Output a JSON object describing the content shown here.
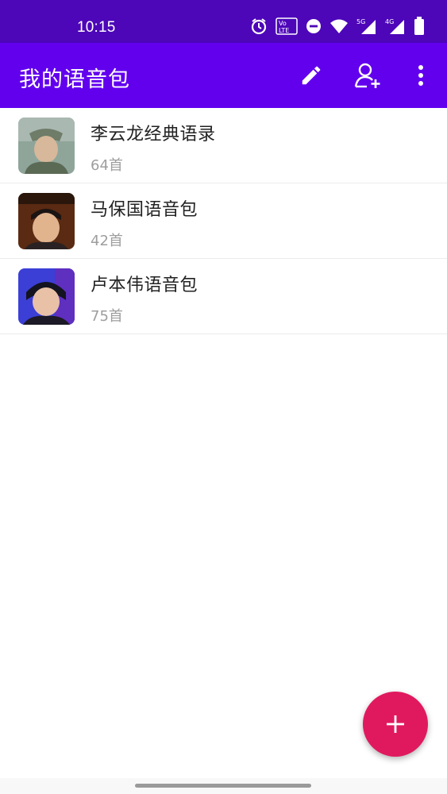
{
  "status": {
    "time": "10:15",
    "icons": [
      "alarm-icon",
      "volte-icon",
      "dnd-icon",
      "wifi-icon",
      "signal-5g-icon",
      "signal-4g-icon",
      "battery-icon"
    ],
    "volte_text": "Vo LTE",
    "net1": "5G",
    "net2": "4G"
  },
  "appbar": {
    "title": "我的语音包",
    "actions": [
      "edit-icon",
      "add-user-icon",
      "more-vert-icon"
    ],
    "color": "#6200ee"
  },
  "list": [
    {
      "title": "李云龙经典语录",
      "count": "64首"
    },
    {
      "title": "马保国语音包",
      "count": "42首"
    },
    {
      "title": "卢本伟语音包",
      "count": "75首"
    }
  ],
  "fab": {
    "icon": "plus-icon",
    "color": "#e0195e"
  }
}
